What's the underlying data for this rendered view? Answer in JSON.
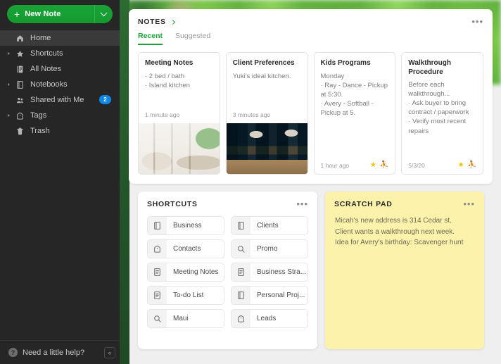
{
  "sidebar": {
    "new_note": {
      "label": "New Note",
      "plus": "+",
      "caret": "chevron-down"
    },
    "items": [
      {
        "label": "Home",
        "icon": "home-icon",
        "active": true,
        "expandable": false,
        "badge": null
      },
      {
        "label": "Shortcuts",
        "icon": "star-icon",
        "active": false,
        "expandable": true,
        "badge": null
      },
      {
        "label": "All Notes",
        "icon": "notes-icon",
        "active": false,
        "expandable": false,
        "badge": null
      },
      {
        "label": "Notebooks",
        "icon": "notebook-icon",
        "active": false,
        "expandable": true,
        "badge": null
      },
      {
        "label": "Shared with Me",
        "icon": "people-icon",
        "active": false,
        "expandable": false,
        "badge": "2"
      },
      {
        "label": "Tags",
        "icon": "tag-icon",
        "active": false,
        "expandable": true,
        "badge": null
      },
      {
        "label": "Trash",
        "icon": "trash-icon",
        "active": false,
        "expandable": false,
        "badge": null
      }
    ],
    "help": {
      "label": "Need a little help?",
      "icon": "question-mark-icon",
      "mark": "?"
    },
    "collapse": {
      "icon": "collapse-sidebar-icon",
      "glyph": "«"
    }
  },
  "notes_panel": {
    "title": "NOTES",
    "more": "•••",
    "tabs": [
      {
        "label": "Recent",
        "active": true
      },
      {
        "label": "Suggested",
        "active": false
      }
    ],
    "cards": [
      {
        "title": "Meeting Notes",
        "lines": [
          "· 2 bed / bath",
          "· Island kitchen"
        ],
        "timestamp": "1 minute ago",
        "starred": false,
        "shared": false,
        "thumb": "living-room-photo"
      },
      {
        "title": "Client Preferences",
        "lines": [
          "Yuki's ideal kitchen."
        ],
        "timestamp": "3 minutes ago",
        "starred": false,
        "shared": false,
        "thumb": "kitchen-photo"
      },
      {
        "title": "Kids Programs",
        "lines": [
          "Monday",
          "· Ray - Dance - Pickup at 5:30.",
          "· Avery - Softball - Pickup at 5."
        ],
        "timestamp": "1 hour ago",
        "starred": true,
        "shared": true,
        "thumb": null
      },
      {
        "title": "Walkthrough Procedure",
        "lines": [
          "Before each walkthrough...",
          "· Ask buyer to bring contract / paperwork",
          "· Verify most recent repairs"
        ],
        "timestamp": "5/3/20",
        "starred": true,
        "shared": true,
        "thumb": null
      }
    ]
  },
  "shortcuts_panel": {
    "title": "SHORTCUTS",
    "more": "•••",
    "items": [
      {
        "label": "Business",
        "icon": "notebook-icon"
      },
      {
        "label": "Clients",
        "icon": "notebook-icon"
      },
      {
        "label": "Contacts",
        "icon": "tag-icon"
      },
      {
        "label": "Promo",
        "icon": "search-icon"
      },
      {
        "label": "Meeting Notes",
        "icon": "note-icon"
      },
      {
        "label": "Business Stra...",
        "icon": "note-icon"
      },
      {
        "label": "To-do List",
        "icon": "note-icon"
      },
      {
        "label": "Personal Proj...",
        "icon": "notebook-icon"
      },
      {
        "label": "Maui",
        "icon": "search-icon"
      },
      {
        "label": "Leads",
        "icon": "tag-icon"
      }
    ]
  },
  "scratch_pad": {
    "title": "SCRATCH PAD",
    "more": "•••",
    "lines": [
      "Micah's new address is 314 Cedar st.",
      "Client wants a walkthrough next week.",
      "Idea for Avery's birthday: Scavenger hunt"
    ]
  },
  "colors": {
    "brand_green": "#19a337",
    "sidebar_bg": "#262626",
    "badge_blue": "#0f87e8",
    "scratch_yellow": "#fdf2ac",
    "star_gold": "#f2c200"
  }
}
